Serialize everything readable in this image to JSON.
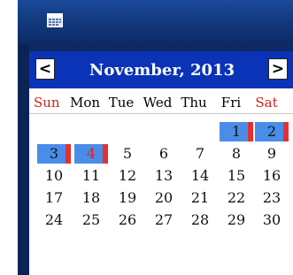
{
  "calendar": {
    "prev_label": "<",
    "next_label": ">",
    "month_title": "November, 2013",
    "weekdays": [
      "Sun",
      "Mon",
      "Tue",
      "Wed",
      "Thu",
      "Fri",
      "Sat"
    ],
    "days": [
      "1",
      "2",
      "3",
      "4",
      "5",
      "6",
      "7",
      "8",
      "9",
      "10",
      "11",
      "12",
      "13",
      "14",
      "15",
      "16",
      "17",
      "18",
      "19",
      "20",
      "21",
      "22",
      "23",
      "24",
      "25",
      "26",
      "27",
      "28",
      "29",
      "30"
    ]
  },
  "icons": {
    "app": "calendar-window-icon"
  },
  "colors": {
    "month_bar": "#0a33b8",
    "weekend_header": "#d4201f",
    "marked_day": "#4a8de8",
    "marker": "#e33030"
  }
}
